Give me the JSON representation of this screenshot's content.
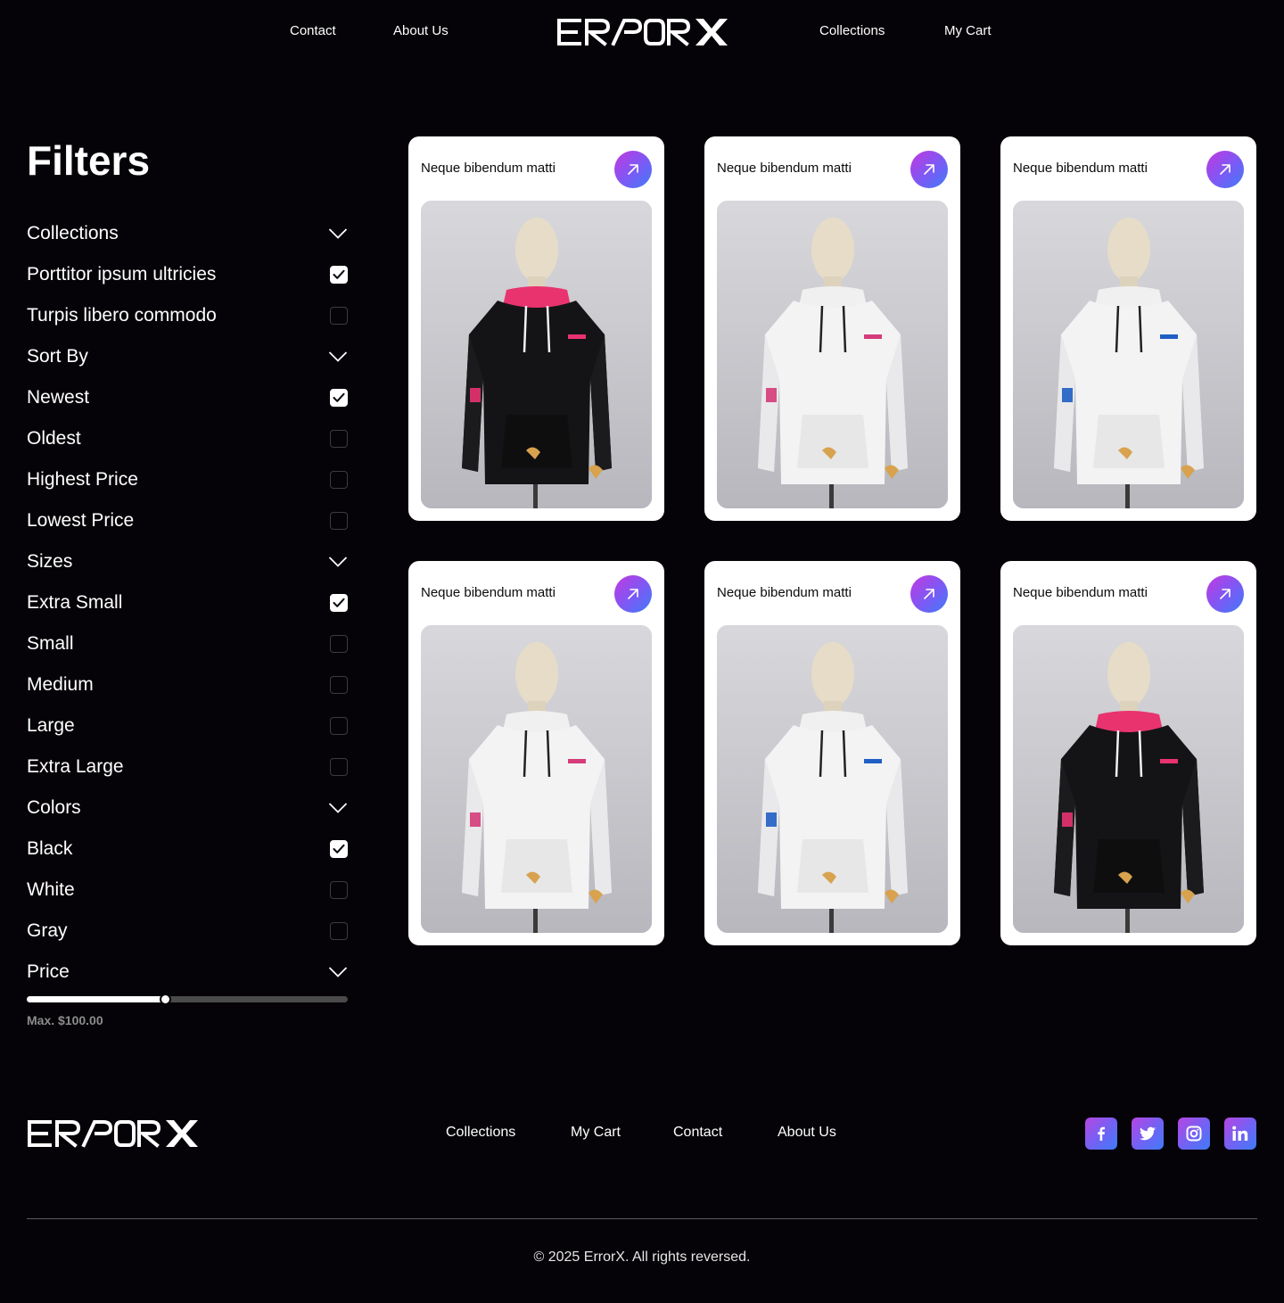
{
  "header": {
    "brand": "ERRORX",
    "nav_left": [
      "Contact",
      "About Us"
    ],
    "nav_right": [
      "Collections",
      "My Cart"
    ]
  },
  "filters": {
    "title": "Filters",
    "rows": [
      {
        "label": "Collections",
        "kind": "section"
      },
      {
        "label": "Porttitor ipsum ultricies",
        "kind": "option",
        "checked": true
      },
      {
        "label": "Turpis libero commodo",
        "kind": "option",
        "checked": false
      },
      {
        "label": "Sort By",
        "kind": "section"
      },
      {
        "label": "Newest",
        "kind": "option",
        "checked": true
      },
      {
        "label": "Oldest",
        "kind": "option",
        "checked": false
      },
      {
        "label": "Highest Price",
        "kind": "option",
        "checked": false
      },
      {
        "label": "Lowest Price",
        "kind": "option",
        "checked": false
      },
      {
        "label": "Sizes",
        "kind": "section"
      },
      {
        "label": "Extra Small",
        "kind": "option",
        "checked": true
      },
      {
        "label": "Small",
        "kind": "option",
        "checked": false
      },
      {
        "label": "Medium",
        "kind": "option",
        "checked": false
      },
      {
        "label": "Large",
        "kind": "option",
        "checked": false
      },
      {
        "label": "Extra Large",
        "kind": "option",
        "checked": false
      },
      {
        "label": "Colors",
        "kind": "section"
      },
      {
        "label": "Black",
        "kind": "option",
        "checked": true
      },
      {
        "label": "White",
        "kind": "option",
        "checked": false
      },
      {
        "label": "Gray",
        "kind": "option",
        "checked": false
      },
      {
        "label": "Price",
        "kind": "section"
      }
    ],
    "price_slider": {
      "fraction": 0.43,
      "caption": "Max. $100.00"
    }
  },
  "products": [
    {
      "title": "Neque bibendum matti",
      "hoodie_color": "black",
      "accent": "#e8336f",
      "hood_lining": "#e8336f"
    },
    {
      "title": "Neque bibendum matti",
      "hoodie_color": "white",
      "accent": "#d63b7a",
      "hood_lining": "#f0f0f0"
    },
    {
      "title": "Neque bibendum matti",
      "hoodie_color": "white",
      "accent": "#1f5fc4",
      "hood_lining": "#f0f0f0"
    },
    {
      "title": "Neque bibendum matti",
      "hoodie_color": "white",
      "accent": "#d63b7a",
      "hood_lining": "#f0f0f0"
    },
    {
      "title": "Neque bibendum matti",
      "hoodie_color": "white",
      "accent": "#1f5fc4",
      "hood_lining": "#f0f0f0"
    },
    {
      "title": "Neque bibendum matti",
      "hoodie_color": "black",
      "accent": "#e8336f",
      "hood_lining": "#e8336f"
    }
  ],
  "footer": {
    "brand": "ERRORX",
    "nav": [
      "Collections",
      "My Cart",
      "Contact",
      "About Us"
    ],
    "social": [
      "facebook-icon",
      "twitter-icon",
      "instagram-icon",
      "linkedin-icon"
    ],
    "copyright": "© 2025 ErrorX. All rights reversed."
  },
  "colors": {
    "background": "#050307",
    "card": "#ffffff",
    "accent_gradient_start": "#c338e0",
    "accent_gradient_end": "#3f7cf7"
  }
}
